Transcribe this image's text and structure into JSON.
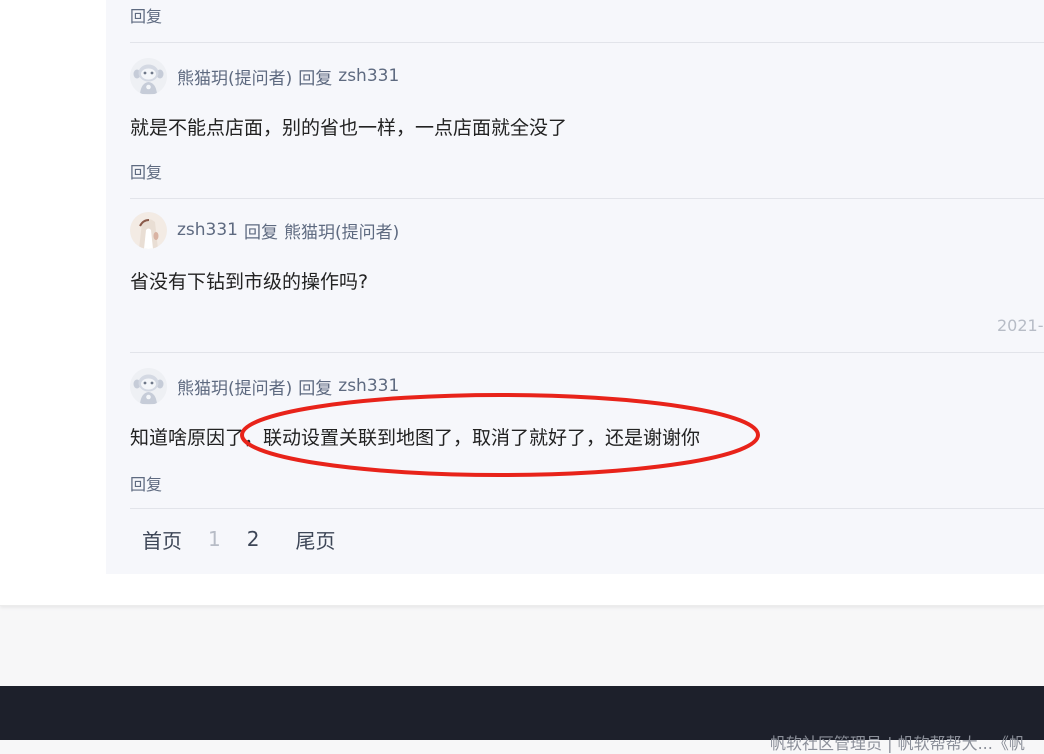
{
  "reply_label": "回复",
  "comments": [
    {
      "author": "熊猫玥(提问者)",
      "verb": "回复",
      "target": "zsh331",
      "body": "就是不能点店面，别的省也一样，一点店面就全没了",
      "reply": "回复"
    },
    {
      "author": "zsh331",
      "verb": "回复",
      "target": "熊猫玥(提问者)",
      "body": "省没有下钻到市级的操作吗?",
      "timestamp": "2021-"
    },
    {
      "author": "熊猫玥(提问者)",
      "verb": "回复",
      "target": "zsh331",
      "body": "知道啥原因了，联动设置关联到地图了，取消了就好了，还是谢谢你",
      "reply": "回复"
    }
  ],
  "pagination": {
    "first": "首页",
    "pages": [
      "1",
      "2"
    ],
    "current": "1",
    "last": "尾页"
  },
  "annotation": {
    "color": "#e8231a"
  },
  "footer": {
    "text": "帆软社区管理员 | 帆软帮帮大...《帆"
  }
}
